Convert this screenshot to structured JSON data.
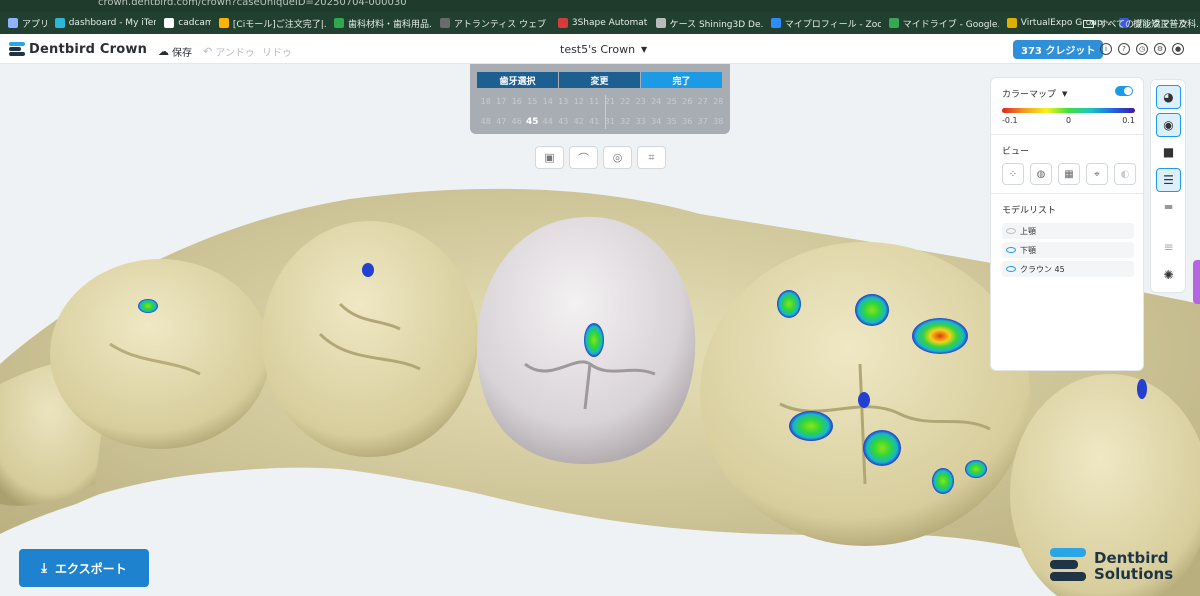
{
  "browser": {
    "url": "crown.dentbird.com/crown?caseUniqueID=20250704-000030",
    "bookmarks": [
      {
        "label": "アプリ",
        "color": "#8fb4ff"
      },
      {
        "label": "dashboard - My iTero",
        "color": "#2bb7d8"
      },
      {
        "label": "cadcam",
        "color": "#ffffff"
      },
      {
        "label": "[Ciモール]ご注文完了|...",
        "color": "#ffb400"
      },
      {
        "label": "歯科材料・歯科用品...",
        "color": "#2fa84f"
      },
      {
        "label": "アトランティス ウェブ オ...",
        "color": "#6a6a6a"
      },
      {
        "label": "3Shape Automate",
        "color": "#d83a3a"
      },
      {
        "label": "ケース Shining3D De...",
        "color": "#bbbbbb"
      },
      {
        "label": "マイプロフィール - Zoom",
        "color": "#2d8cff"
      },
      {
        "label": "マイドライブ - Google...",
        "color": "#34a853"
      },
      {
        "label": "VirtualExpo Group -...",
        "color": "#e0b000"
      },
      {
        "label": "機能矯正普及科...",
        "color": "#3b5bdb"
      }
    ],
    "bookmarks_more": "»",
    "all_bookmarks": "すべてのブックマーク"
  },
  "header": {
    "logo": "Dentbird Crown",
    "save": "保存",
    "undo": "アンドゥ",
    "redo": "リドゥ",
    "case_title": "test5's Crown",
    "credits": "373 クレジット"
  },
  "tooth_panel": {
    "tabs": [
      {
        "label": "歯牙選択",
        "active": false
      },
      {
        "label": "変更",
        "active": false
      },
      {
        "label": "完了",
        "active": true
      }
    ],
    "upper_row": [
      "18",
      "17",
      "16",
      "15",
      "14",
      "13",
      "12",
      "11",
      "21",
      "22",
      "23",
      "24",
      "25",
      "26",
      "27",
      "28"
    ],
    "lower_row": [
      "48",
      "47",
      "46",
      "45",
      "44",
      "43",
      "42",
      "41",
      "31",
      "32",
      "33",
      "34",
      "35",
      "36",
      "37",
      "38"
    ],
    "selected": "45"
  },
  "colormap": {
    "title": "カラーマップ",
    "enabled": true,
    "min": "-0.1",
    "mid": "0",
    "max": "0.1"
  },
  "view": {
    "title": "ビュー"
  },
  "model_list": {
    "title": "モデルリスト",
    "items": [
      {
        "label": "上顎",
        "visible": false
      },
      {
        "label": "下顎",
        "visible": true
      },
      {
        "label": "クラウン 45",
        "visible": true
      }
    ]
  },
  "export": {
    "label": "エクスポート"
  },
  "brand": {
    "line1": "Dentbird",
    "line2": "Solutions"
  },
  "colors": {
    "accent": "#1d9ae6",
    "export": "#1e82cf",
    "gum": "#d9d0a4"
  }
}
